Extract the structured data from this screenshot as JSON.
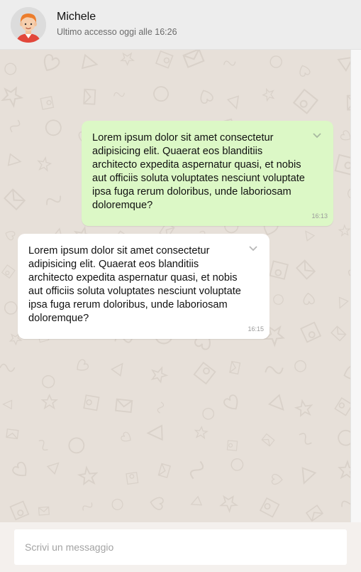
{
  "header": {
    "contact_name": "Michele",
    "status": "Ultimo accesso oggi alle 16:26"
  },
  "messages": [
    {
      "direction": "outgoing",
      "text": "Lorem ipsum dolor sit amet consectetur adipisicing elit. Quaerat eos blanditiis architecto expedita aspernatur quasi, et nobis aut officiis soluta voluptates nesciunt voluptate ipsa fuga rerum doloribus, unde laboriosam doloremque?",
      "time": "16:13",
      "background": "#dcf8c6"
    },
    {
      "direction": "incoming",
      "text": "Lorem ipsum dolor sit amet consectetur adipisicing elit. Quaerat eos blanditiis architecto expedita aspernatur quasi, et nobis aut officiis soluta voluptates nesciunt voluptate ipsa fuga rerum doloribus, unde laboriosam doloremque?",
      "time": "16:15",
      "background": "#ffffff"
    }
  ],
  "composer": {
    "placeholder": "Scrivi un messaggio",
    "value": ""
  },
  "icons": {
    "avatar": "avatar-icon",
    "message_menu": "chevron-down-icon"
  },
  "colors": {
    "header_bg": "#ededed",
    "chat_bg": "#e7e0d9",
    "footer_bg": "#f4f0ed",
    "outgoing_bubble": "#dcf8c6",
    "incoming_bubble": "#ffffff"
  }
}
